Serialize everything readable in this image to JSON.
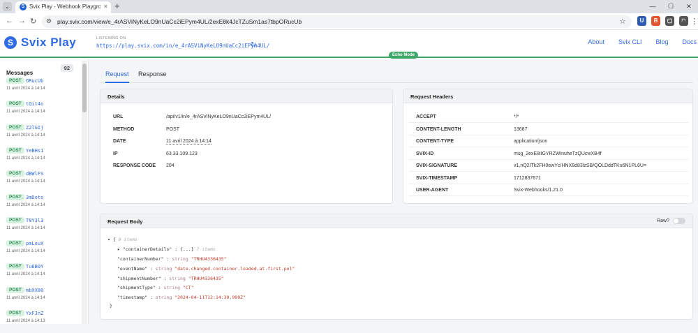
{
  "browser": {
    "tab_title": "Svix Play - Webhook Playgroun",
    "tab_close": "×",
    "new_tab": "+",
    "url": "play.svix.com/view/e_4rASViNyKeLO9nUaCc2iEPym4UL/2exE8k4JcTZuSm1as7tbpORucUb",
    "controls": {
      "minimize": "—",
      "maximize": "☐",
      "close": "✕"
    },
    "extensions": [
      {
        "icon": "u-extension-icon",
        "letter": "U",
        "color": "#2d5bb5"
      },
      {
        "icon": "b-extension-icon",
        "letter": "B",
        "color": "#e0552b"
      },
      {
        "icon": "document-extension-icon",
        "letter": "▢",
        "color": "#555555"
      },
      {
        "icon": "puzzle-icon",
        "letter": "⧉",
        "color": "#555555"
      }
    ]
  },
  "header": {
    "logo_text": "Svix Play",
    "logo_mark": "S",
    "listening_label": "LISTENING ON",
    "listening_url": "https://play.svix.com/in/e_4rASViNyKeLO9nUaCc2iEPym4UL/",
    "nav": [
      "About",
      "Svix CLI",
      "Blog",
      "Docs"
    ],
    "echo_mode": "Echo Mode"
  },
  "sidebar": {
    "title": "Messages",
    "count": "92",
    "messages": [
      {
        "method": "POST",
        "id": "ORucUb",
        "date": "11 avril 2024 à 14:14"
      },
      {
        "method": "POST",
        "id": "tQit4o",
        "date": "11 avril 2024 à 14:14"
      },
      {
        "method": "POST",
        "id": "Z2lGIj",
        "date": "11 avril 2024 à 14:14"
      },
      {
        "method": "POST",
        "id": "YeBHs1",
        "date": "11 avril 2024 à 14:14"
      },
      {
        "method": "POST",
        "id": "dBWlFS",
        "date": "11 avril 2024 à 14:14"
      },
      {
        "method": "POST",
        "id": "3mDoto",
        "date": "11 avril 2024 à 14:14"
      },
      {
        "method": "POST",
        "id": "T8Y3l3",
        "date": "11 avril 2024 à 14:14"
      },
      {
        "method": "POST",
        "id": "pmLouX",
        "date": "11 avril 2024 à 14:14"
      },
      {
        "method": "POST",
        "id": "Tu6B0Y",
        "date": "11 avril 2024 à 14:14"
      },
      {
        "method": "POST",
        "id": "mbXX80",
        "date": "11 avril 2024 à 14:14"
      },
      {
        "method": "POST",
        "id": "YxFJnZ",
        "date": "11 avril 2024 à 14:13"
      }
    ]
  },
  "tabs": {
    "request": "Request",
    "response": "Response"
  },
  "details": {
    "title": "Details",
    "rows": [
      {
        "key": "URL",
        "value": "/api/v1/in/e_4rASViNyKeLO9nUaCc2iEPym4UL/"
      },
      {
        "key": "METHOD",
        "value": "POST"
      },
      {
        "key": "DATE",
        "value": "11 avril 2024 à 14:14"
      },
      {
        "key": "IP",
        "value": "63.33.109.123"
      },
      {
        "key": "RESPONSE CODE",
        "value": "204"
      }
    ]
  },
  "request_headers": {
    "title": "Request Headers",
    "rows": [
      {
        "key": "ACCEPT",
        "value": "*/*"
      },
      {
        "key": "CONTENT-LENGTH",
        "value": "13687"
      },
      {
        "key": "CONTENT-TYPE",
        "value": "application/json"
      },
      {
        "key": "SVIX-ID",
        "value": "msg_2exE8iIGYRZWinuheTzQUcwXB4f"
      },
      {
        "key": "SVIX-SIGNATURE",
        "value": "v1,nQ2ITk2FH0ewYc/HNX8d83lzSB/QOLDddTKu6N1PL6U="
      },
      {
        "key": "SVIX-TIMESTAMP",
        "value": "1712837671"
      },
      {
        "key": "USER-AGENT",
        "value": "Svix-Webhooks/1.21.0"
      }
    ]
  },
  "request_body": {
    "title": "Request Body",
    "raw_label": "Raw?",
    "root_meta": "6 items",
    "collapsed_key": "\"containerDetails\"",
    "collapsed_value": "{...}",
    "collapsed_meta": "7 items",
    "type_label": "string",
    "fields": [
      {
        "key": "\"containerNumber\"",
        "value": "\"TRHU4336435\""
      },
      {
        "key": "\"eventName\"",
        "value": "\"date.changed.container.loaded.at.first.pol\""
      },
      {
        "key": "\"shipmentNumber\"",
        "value": "\"TRHU4336435\""
      },
      {
        "key": "\"shipmentType\"",
        "value": "\"CT\""
      },
      {
        "key": "\"timestamp\"",
        "value": "\"2024-04-11T12:14:30.999Z\""
      }
    ]
  }
}
